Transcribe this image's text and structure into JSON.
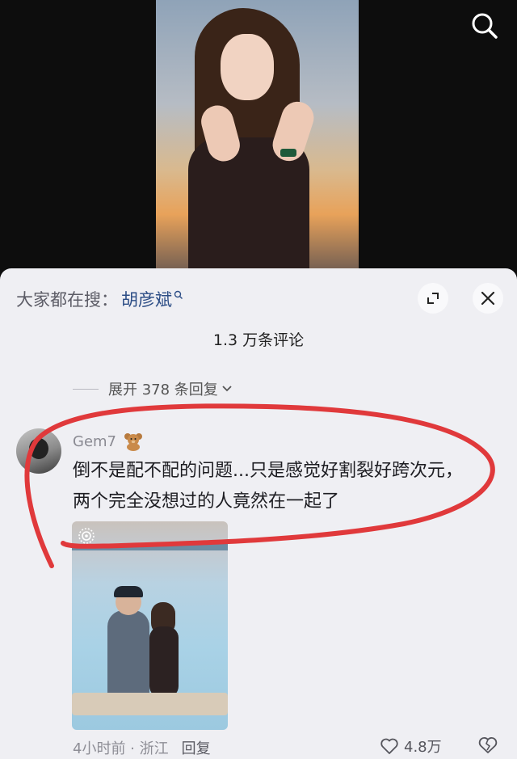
{
  "video": {
    "search_icon": "search-icon"
  },
  "comments_panel": {
    "hot_search_prefix": "大家都在搜：",
    "hot_search_term": "胡彦斌",
    "expand_icon": "expand-icon",
    "close_icon": "close-icon",
    "comment_count": "1.3 万条评论",
    "expand_replies": "展开 378 条回复"
  },
  "comment": {
    "username": "Gem7",
    "badge_icon": "teddy-bear-icon",
    "text_line1": "倒不是配不配的问题...只是感觉好割裂好跨次元，",
    "text_line2": "两个完全没想过的人竟然在一起了",
    "time_location": "4小时前 · 浙江",
    "reply_label": "回复",
    "likes": "4.8万"
  },
  "colors": {
    "annotation_red": "#e0393b",
    "link_blue": "#2d4e86",
    "panel_bg": "#efeff3"
  }
}
